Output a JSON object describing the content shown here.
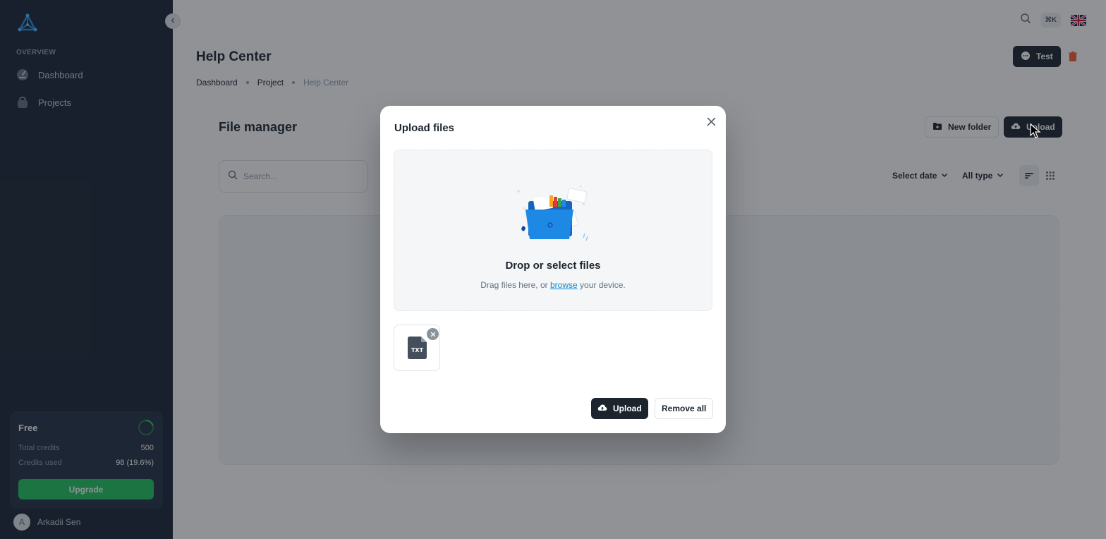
{
  "sidebar": {
    "section_label": "OVERVIEW",
    "items": [
      {
        "label": "Dashboard",
        "icon": "dashboard-icon"
      },
      {
        "label": "Projects",
        "icon": "projects-icon"
      }
    ],
    "credits": {
      "plan": "Free",
      "total_label": "Total credits",
      "total_value": "500",
      "used_label": "Credits used",
      "used_value": "98 (19.6%)",
      "used_fraction": 0.196,
      "upgrade_label": "Upgrade"
    },
    "user": {
      "initial": "A",
      "name": "Arkadii Sen"
    }
  },
  "topbar": {
    "shortcut": "⌘K",
    "language_icon": "uk-flag-icon"
  },
  "header": {
    "title": "Help Center",
    "breadcrumb": [
      "Dashboard",
      "Project",
      "Help Center"
    ],
    "test_label": "Test"
  },
  "file_manager": {
    "title": "File manager",
    "new_folder_label": "New folder",
    "upload_label": "Upload",
    "search_placeholder": "Search...",
    "filter_date": "Select date",
    "filter_type": "All type"
  },
  "dialog": {
    "title": "Upload files",
    "drop_title": "Drop or select files",
    "drop_sub_before": "Drag files here, or",
    "drop_sub_link": "browse",
    "drop_sub_after": "your device.",
    "file_type": "TXT",
    "upload_label": "Upload",
    "remove_all_label": "Remove all"
  },
  "colors": {
    "sidebar_bg": "#1c2536",
    "dark_button": "#1c252e",
    "upgrade_green": "#22c55e",
    "danger": "#ff5630",
    "link": "#0c8cda"
  }
}
